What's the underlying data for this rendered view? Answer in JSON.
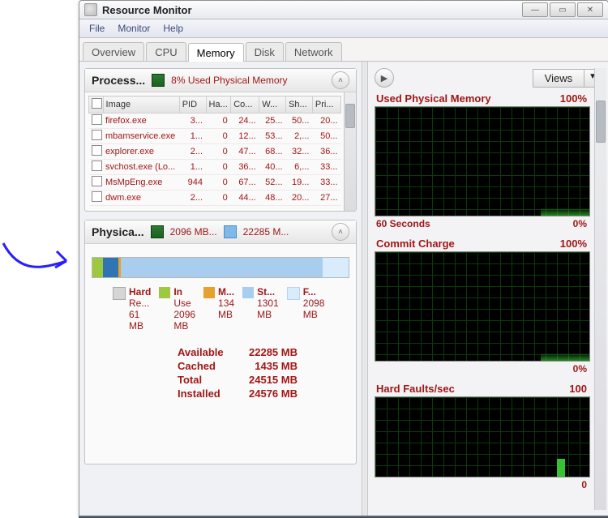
{
  "window": {
    "title": "Resource Monitor"
  },
  "menu": {
    "file": "File",
    "monitor": "Monitor",
    "help": "Help"
  },
  "tabs": {
    "overview": "Overview",
    "cpu": "CPU",
    "memory": "Memory",
    "disk": "Disk",
    "network": "Network"
  },
  "processes": {
    "title": "Process...",
    "usage_label": "8% Used Physical Memory",
    "columns": {
      "ck": "",
      "image": "Image",
      "pid": "PID",
      "hard": "Ha...",
      "commit": "Co...",
      "ws": "W...",
      "sh": "Sh...",
      "priv": "Pri..."
    },
    "rows": [
      {
        "image": "firefox.exe",
        "pid": "3...",
        "hard": "0",
        "commit": "24...",
        "ws": "25...",
        "sh": "50...",
        "priv": "20..."
      },
      {
        "image": "mbamservice.exe",
        "pid": "1...",
        "hard": "0",
        "commit": "12...",
        "ws": "53...",
        "sh": "2,...",
        "priv": "50..."
      },
      {
        "image": "explorer.exe",
        "pid": "2...",
        "hard": "0",
        "commit": "47...",
        "ws": "68...",
        "sh": "32...",
        "priv": "36..."
      },
      {
        "image": "svchost.exe (Lo...",
        "pid": "1...",
        "hard": "0",
        "commit": "36...",
        "ws": "40...",
        "sh": "6,...",
        "priv": "33..."
      },
      {
        "image": "MsMpEng.exe",
        "pid": "944",
        "hard": "0",
        "commit": "67...",
        "ws": "52...",
        "sh": "19...",
        "priv": "33..."
      },
      {
        "image": "dwm.exe",
        "pid": "2...",
        "hard": "0",
        "commit": "44...",
        "ws": "48...",
        "sh": "20...",
        "priv": "27..."
      }
    ]
  },
  "physical_panel": {
    "title": "Physica...",
    "chip1": "2096 MB...",
    "chip2": "22285 M..."
  },
  "memory": {
    "segments_pct": {
      "hard": 4,
      "in_use": 6,
      "modified": 1,
      "standby": 79,
      "free": 10
    },
    "legend": {
      "hard": {
        "l1": "Hard",
        "l2": "Re...",
        "l3": "61",
        "l4": "MB"
      },
      "in_use": {
        "l1": "In",
        "l2": "Use",
        "l3": "2096",
        "l4": "MB"
      },
      "mod": {
        "l1": "M...",
        "l2": "134",
        "l3": "MB"
      },
      "stby": {
        "l1": "St...",
        "l2": "1301",
        "l3": "MB"
      },
      "free": {
        "l1": "F...",
        "l2": "2098",
        "l3": "MB"
      }
    },
    "totals": {
      "available_l": "Available",
      "available_v": "22285 MB",
      "cached_l": "Cached",
      "cached_v": "1435 MB",
      "total_l": "Total",
      "total_v": "24515 MB",
      "installed_l": "Installed",
      "installed_v": "24576 MB"
    }
  },
  "graphs": {
    "views": "Views",
    "g1": {
      "title": "Used Physical Memory",
      "tr": "100%",
      "bl": "60 Seconds",
      "br": "0%"
    },
    "g2": {
      "title": "Commit Charge",
      "tr": "100%",
      "br": "0%"
    },
    "g3": {
      "title": "Hard Faults/sec",
      "tr": "100",
      "br": "0"
    }
  },
  "chart_data": [
    {
      "type": "line",
      "title": "Used Physical Memory",
      "xlabel": "60 Seconds",
      "ylabel": "%",
      "ylim": [
        0,
        100
      ],
      "series": [
        {
          "name": "Used",
          "values": [
            8,
            8,
            8,
            8,
            8,
            8,
            8,
            8,
            8,
            8
          ]
        }
      ]
    },
    {
      "type": "line",
      "title": "Commit Charge",
      "xlabel": "60 Seconds",
      "ylabel": "%",
      "ylim": [
        0,
        100
      ],
      "series": [
        {
          "name": "Commit",
          "values": [
            10,
            10,
            10,
            10,
            10,
            10,
            10,
            10,
            10,
            10
          ]
        }
      ]
    },
    {
      "type": "line",
      "title": "Hard Faults/sec",
      "xlabel": "60 Seconds",
      "ylabel": "faults/sec",
      "ylim": [
        0,
        100
      ],
      "series": [
        {
          "name": "Faults",
          "values": [
            0,
            0,
            0,
            0,
            0,
            0,
            0,
            0,
            20,
            0
          ]
        }
      ]
    },
    {
      "type": "bar",
      "title": "Physical Memory",
      "categories": [
        "Hardware Reserved",
        "In Use",
        "Modified",
        "Standby",
        "Free"
      ],
      "values": [
        61,
        2096,
        134,
        13012,
        2098
      ],
      "ylabel": "MB"
    }
  ]
}
